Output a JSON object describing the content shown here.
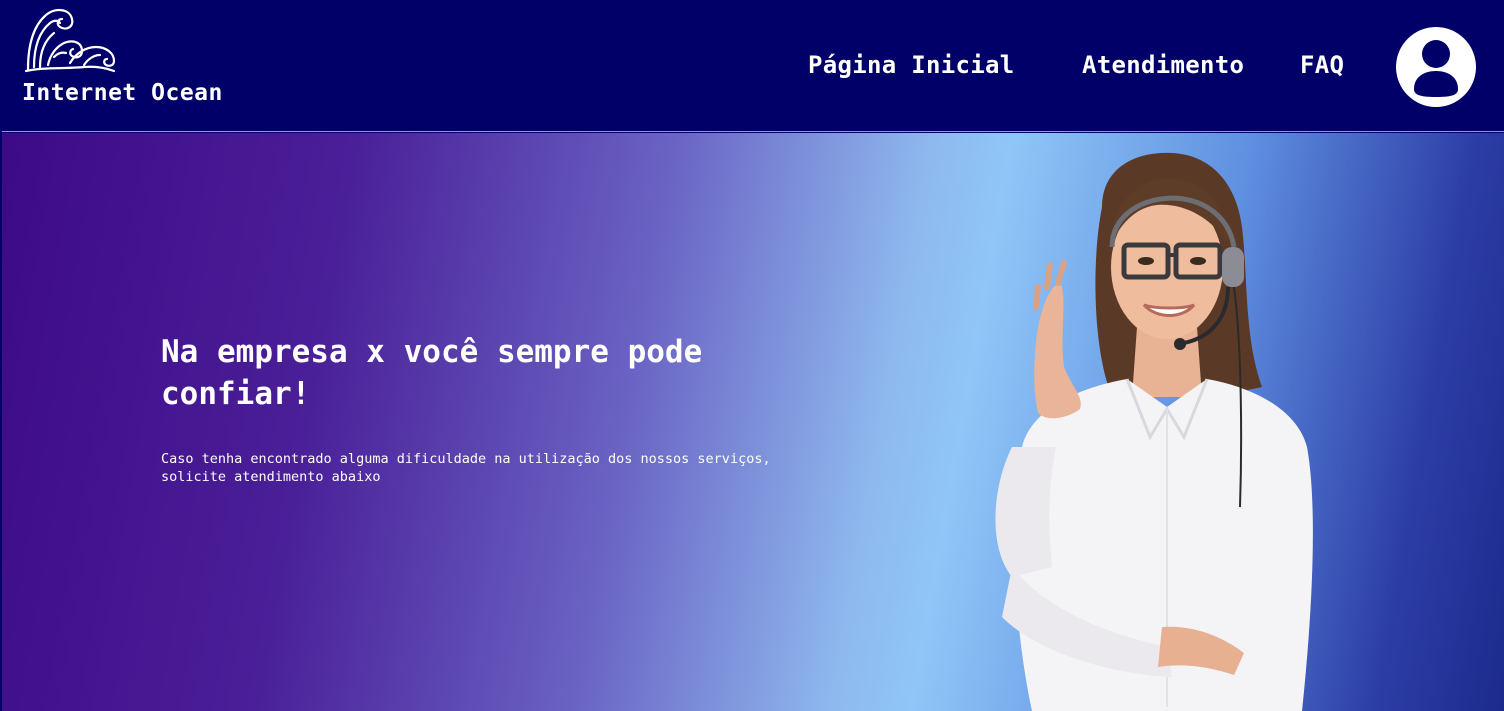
{
  "brand": {
    "name": "Internet Ocean",
    "logo_icon": "wave-logo-icon"
  },
  "nav": {
    "links": [
      {
        "label": "Página Inicial"
      },
      {
        "label": "Atendimento"
      },
      {
        "label": "FAQ"
      }
    ],
    "avatar_icon": "user-avatar-icon"
  },
  "hero": {
    "title": "Na empresa x você sempre pode confiar!",
    "description": "Caso tenha encontrado alguma dificuldade na utilização dos nossos serviços, solicite atendimento abaixo",
    "image": "support-agent-with-headset"
  },
  "colors": {
    "navbar": "#000068",
    "gradient_purple": "#3d0a87",
    "gradient_light_blue": "#8fc6f7",
    "gradient_dark_blue": "#1c2a8c",
    "text": "#ffffff"
  }
}
